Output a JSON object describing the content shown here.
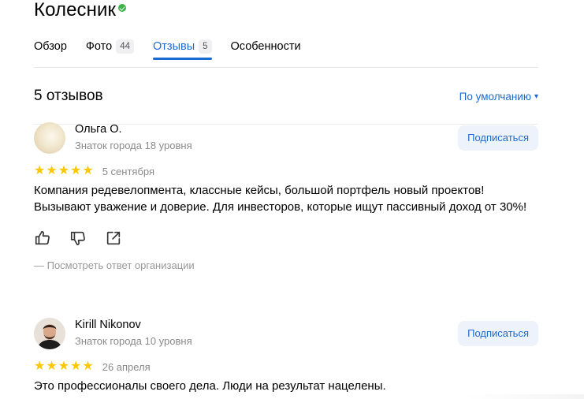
{
  "header": {
    "title": "Колесник"
  },
  "tabs": [
    {
      "label": "Обзор",
      "count": null,
      "active": false
    },
    {
      "label": "Фото",
      "count": "44",
      "active": false
    },
    {
      "label": "Отзывы",
      "count": "5",
      "active": true
    },
    {
      "label": "Особенности",
      "count": null,
      "active": false
    }
  ],
  "reviews_header": {
    "count_label": "5 отзывов",
    "sort_label": "По умолчанию",
    "sort_arrow": "▾"
  },
  "reviews": [
    {
      "author": "Ольга О.",
      "level": "Знаток города 18 уровня",
      "subscribe_label": "Подписаться",
      "rating": 5,
      "date": "5 сентября",
      "text": "Компания редевелопмента, классные кейсы, большой портфель новый проектов! Вызывают уважение и доверие. Для инвесторов, которые ищут пассивный доход от 30%!",
      "org_reply_label": "— Посмотреть ответ организации"
    },
    {
      "author": "Kirill Nikonov",
      "level": "Знаток города 10 уровня",
      "subscribe_label": "Подписаться",
      "rating": 5,
      "date": "26 апреля",
      "text": "Это профессионалы своего дела. Люди на результат нацелены."
    }
  ],
  "icons": {
    "verified": "verified-check-icon",
    "like": "thumbs-up-icon",
    "dislike": "thumbs-down-icon",
    "share": "share-icon",
    "star": "star-icon"
  },
  "colors": {
    "accent": "#1a6bd1",
    "star": "#fdc800",
    "verified": "#3bb54a",
    "muted": "#8a8a8a"
  }
}
